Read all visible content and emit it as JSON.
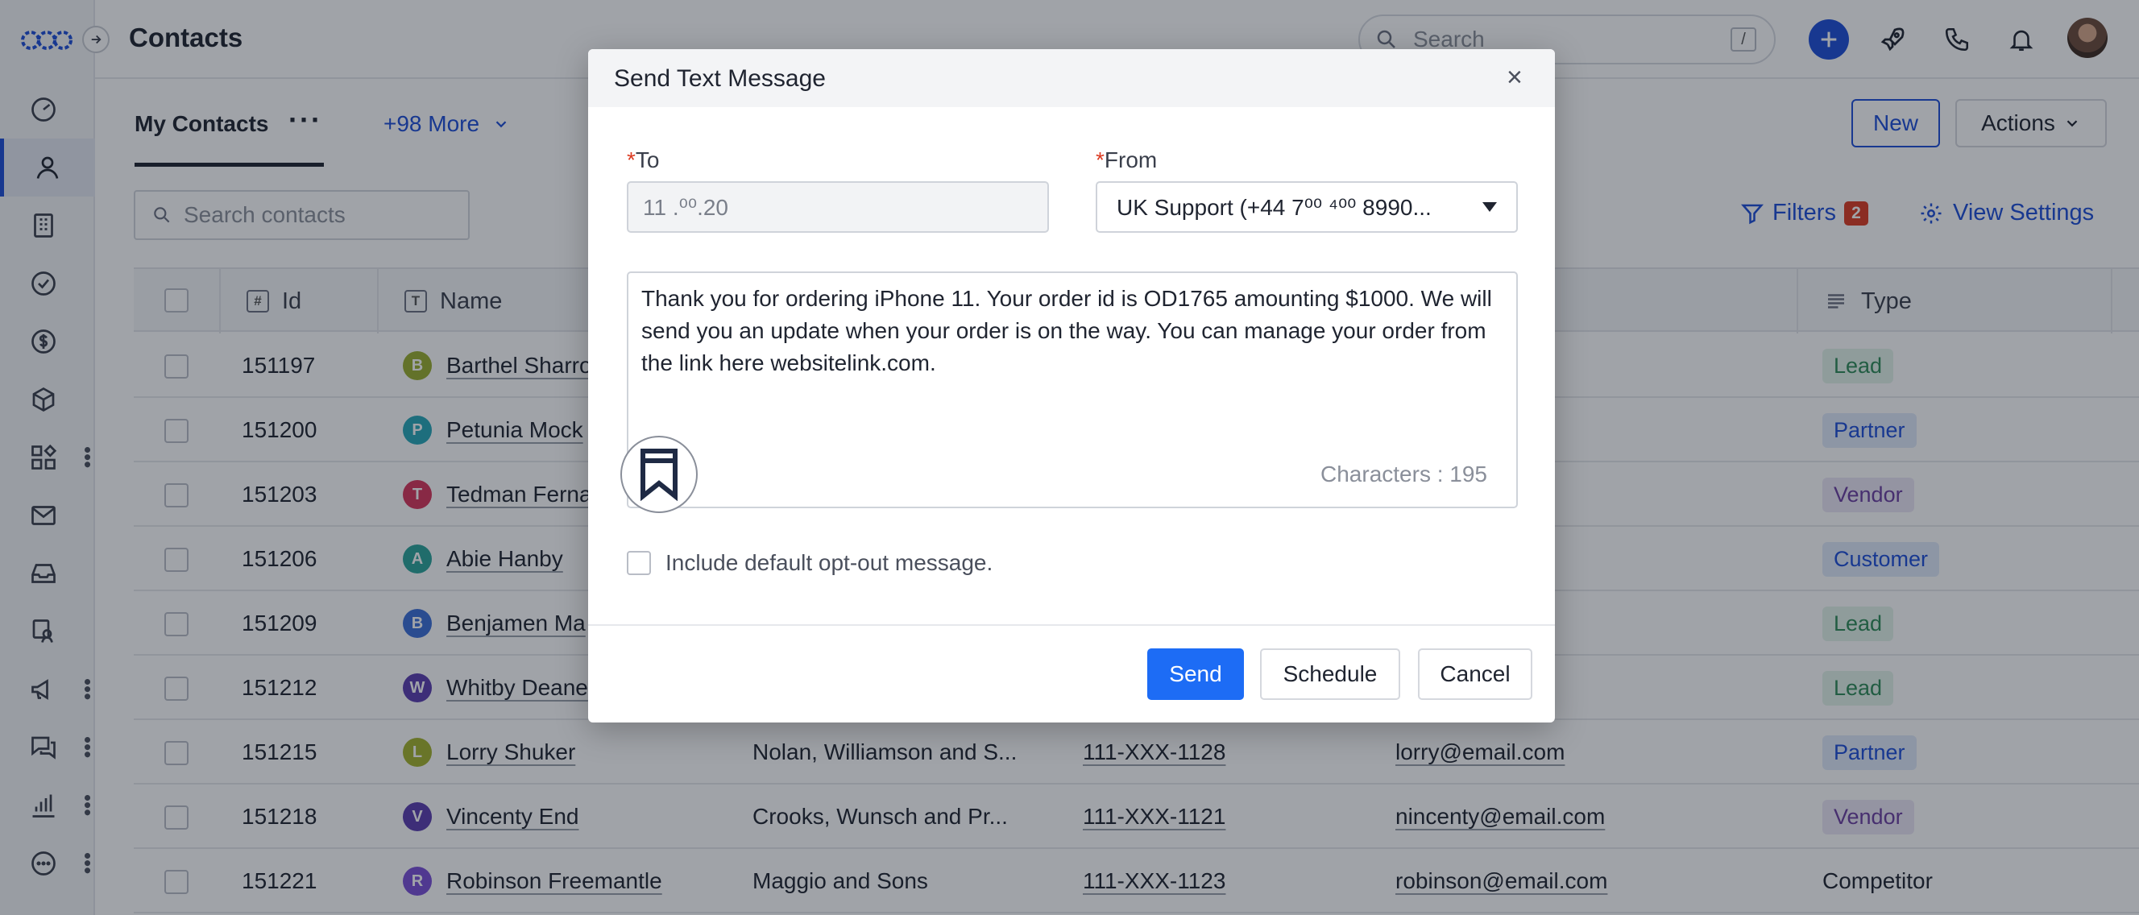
{
  "app": {
    "title": "Contacts"
  },
  "header": {
    "search_placeholder": "Search",
    "search_shortcut": "/"
  },
  "tabs": {
    "active": "My Contacts",
    "more": "+98 More"
  },
  "toolbar": {
    "new_label": "New",
    "actions_label": "Actions",
    "search_placeholder": "Search contacts",
    "filters_label": "Filters",
    "filters_count": "2",
    "view_settings_label": "View Settings"
  },
  "table": {
    "columns": {
      "id": "Id",
      "name": "Name",
      "type": "Type"
    },
    "rows": [
      {
        "id": "151197",
        "initial": "B",
        "name": "Barthel Sharro",
        "company": "",
        "phone": "",
        "email": ".com",
        "type": "Lead"
      },
      {
        "id": "151200",
        "initial": "P",
        "name": "Petunia Mock",
        "company": "",
        "phone": "",
        "email": ".com",
        "type": "Partner"
      },
      {
        "id": "151203",
        "initial": "T",
        "name": "Tedman Ferna",
        "company": "",
        "phone": "",
        "email": ".com",
        "type": "Vendor"
      },
      {
        "id": "151206",
        "initial": "A",
        "name": "Abie Hanby",
        "company": "",
        "phone": "",
        "email": "m",
        "type": "Customer"
      },
      {
        "id": "151209",
        "initial": "B",
        "name": "Benjamen Ma",
        "company": "",
        "phone": "",
        "email": "ail.com",
        "type": "Lead"
      },
      {
        "id": "151212",
        "initial": "W",
        "name": "Whitby Deane",
        "company": "",
        "phone": "",
        "email": "om",
        "type": "Lead"
      },
      {
        "id": "151215",
        "initial": "L",
        "name": "Lorry Shuker",
        "company": "Nolan, Williamson and S...",
        "phone": "111-XXX-1128",
        "email": "lorry@email.com",
        "type": "Partner"
      },
      {
        "id": "151218",
        "initial": "V",
        "name": "Vincenty End",
        "company": "Crooks, Wunsch and Pr...",
        "phone": "111-XXX-1121",
        "email": "nincenty@email.com",
        "type": "Vendor"
      },
      {
        "id": "151221",
        "initial": "R",
        "name": "Robinson Freemantle",
        "company": "Maggio and Sons",
        "phone": "111-XXX-1123",
        "email": "robinson@email.com",
        "type": "Competitor"
      }
    ]
  },
  "colors": {
    "accent": "#1d4ed8",
    "lead_bg": "#e3f3ea",
    "lead_fg": "#2e8b57",
    "partner_bg": "#dfeafb",
    "partner_fg": "#1d4ed8",
    "vendor_bg": "#ece7f6",
    "vendor_fg": "#6b3fa0",
    "customer_bg": "#dfeafb",
    "customer_fg": "#1d4ed8"
  },
  "modal": {
    "title": "Send Text Message",
    "to_label": "To",
    "to_value": "11 .⁰⁰.20",
    "from_label": "From",
    "from_value": "UK Support (+44 7⁰⁰ ⁴⁰⁰ 8990...",
    "message": "Thank you for ordering iPhone 11. Your order id is OD1765 amounting $1000.  We will send you an update when your order is on the way. You can manage your order from the link here websitelink.com.",
    "char_count": "Characters : 195",
    "optout_label": "Include default opt-out message.",
    "send_label": "Send",
    "schedule_label": "Schedule",
    "cancel_label": "Cancel"
  }
}
